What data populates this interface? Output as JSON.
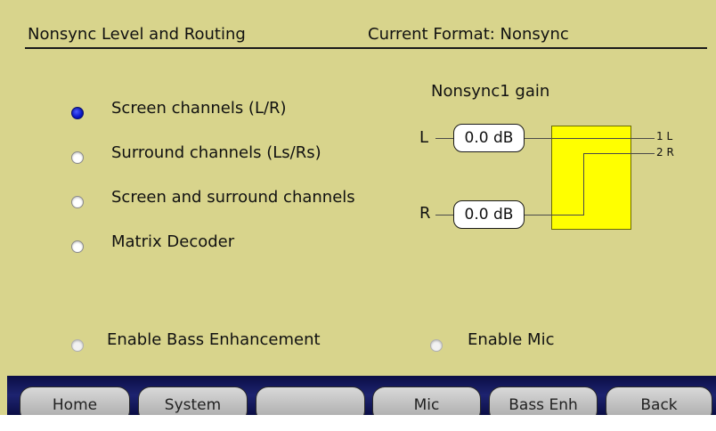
{
  "header": {
    "title": "Nonsync Level and Routing",
    "format": "Current Format: Nonsync"
  },
  "routing_options": [
    {
      "label": "Screen channels (L/R)",
      "selected": true
    },
    {
      "label": "Surround channels (Ls/Rs)",
      "selected": false
    },
    {
      "label": "Screen and surround channels",
      "selected": false
    },
    {
      "label": "Matrix Decoder",
      "selected": false
    }
  ],
  "options": {
    "bass_enhancement": {
      "label": "Enable Bass Enhancement",
      "checked": false
    },
    "mic": {
      "label": "Enable Mic",
      "checked": false
    }
  },
  "gain": {
    "title": "Nonsync1 gain",
    "inputs": [
      {
        "label": "L",
        "value": "0.0 dB"
      },
      {
        "label": "R",
        "value": "0.0 dB"
      }
    ],
    "outputs": [
      "1 L",
      "2 R"
    ]
  },
  "nav": {
    "buttons": [
      "Home",
      "System",
      "",
      "Mic",
      "Bass Enh",
      "Back"
    ]
  },
  "colors": {
    "background": "#d8d48c",
    "routing_block": "#ffff00",
    "selected_radio": "#0a17c8",
    "nav_bar": "#1d2370"
  }
}
